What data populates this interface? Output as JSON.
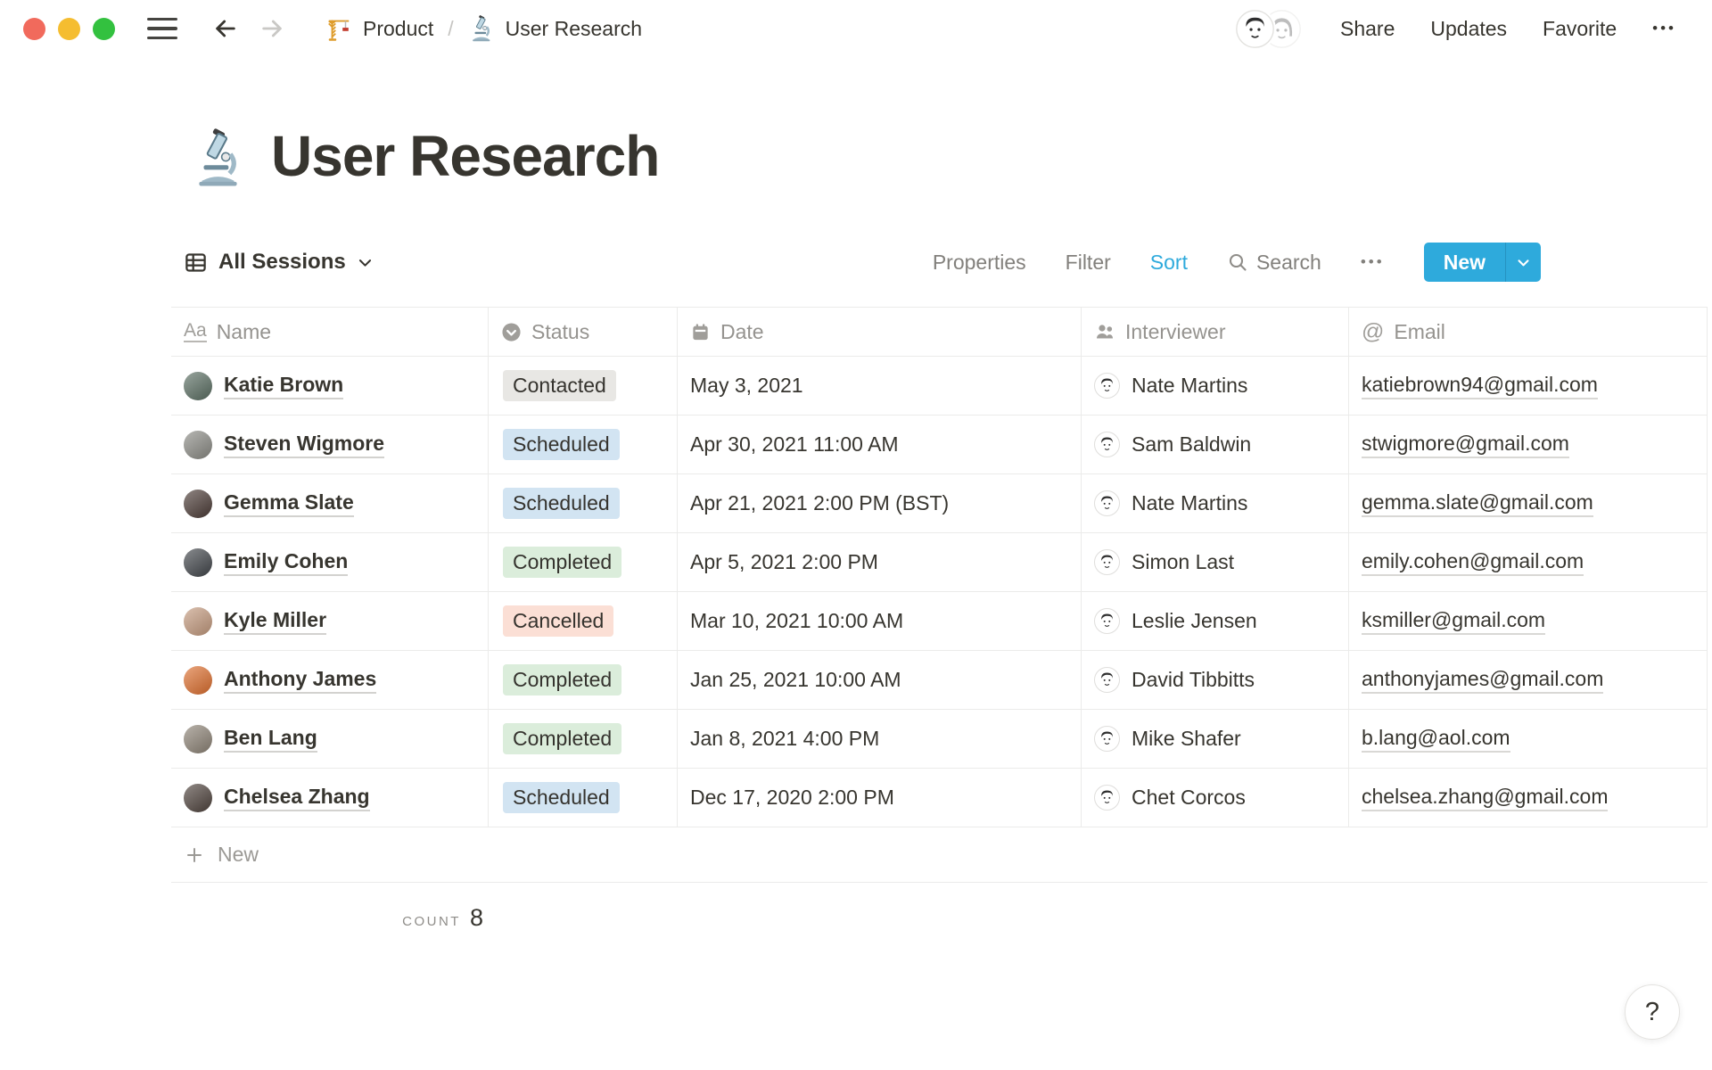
{
  "window": {
    "traffic_lights": [
      "#F16A5C",
      "#F5BD30",
      "#33C13F"
    ]
  },
  "topbar": {
    "breadcrumb": [
      {
        "icon": "crane-icon",
        "label": "Product"
      },
      {
        "icon": "microscope-icon",
        "label": "User Research"
      }
    ],
    "separator": "/",
    "actions": [
      "Share",
      "Updates",
      "Favorite"
    ],
    "more_label": "•••"
  },
  "page": {
    "icon": "microscope-icon",
    "title": "User Research"
  },
  "view_toolbar": {
    "view_name": "All Sessions",
    "menu": [
      {
        "label": "Properties",
        "active": false
      },
      {
        "label": "Filter",
        "active": false
      },
      {
        "label": "Sort",
        "active": true
      }
    ],
    "search_label": "Search",
    "more_label": "•••",
    "accent_color": "#2EAADC",
    "new_button": {
      "label": "New",
      "color": "#2EAADC"
    }
  },
  "table": {
    "columns": [
      {
        "key": "name",
        "label": "Name",
        "icon": "text-icon"
      },
      {
        "key": "status",
        "label": "Status",
        "icon": "select-icon"
      },
      {
        "key": "date",
        "label": "Date",
        "icon": "calendar-icon"
      },
      {
        "key": "interviewer",
        "label": "Interviewer",
        "icon": "person-icon"
      },
      {
        "key": "email",
        "label": "Email",
        "icon": "at-icon"
      }
    ],
    "status_colors": {
      "Contacted": "#E8E7E4",
      "Scheduled": "#D2E4F2",
      "Completed": "#DBEDDB",
      "Cancelled": "#FBDFD5"
    },
    "rows": [
      {
        "name": "Katie Brown",
        "avatar_color": "#5A6E62",
        "status": "Contacted",
        "date": "May 3, 2021",
        "interviewer": "Nate Martins",
        "email": "katiebrown94@gmail.com"
      },
      {
        "name": "Steven Wigmore",
        "avatar_color": "#8B8B85",
        "status": "Scheduled",
        "date": "Apr 30, 2021 11:00 AM",
        "interviewer": "Sam Baldwin",
        "email": "stwigmore@gmail.com"
      },
      {
        "name": "Gemma Slate",
        "avatar_color": "#4B3B36",
        "status": "Scheduled",
        "date": "Apr 21, 2021 2:00 PM (BST)",
        "interviewer": "Nate Martins",
        "email": "gemma.slate@gmail.com"
      },
      {
        "name": "Emily Cohen",
        "avatar_color": "#41454A",
        "status": "Completed",
        "date": "Apr 5, 2021 2:00 PM",
        "interviewer": "Simon Last",
        "email": "emily.cohen@gmail.com"
      },
      {
        "name": "Kyle Miller",
        "avatar_color": "#C49A7E",
        "status": "Cancelled",
        "date": "Mar 10, 2021 10:00 AM",
        "interviewer": "Leslie Jensen",
        "email": "ksmiller@gmail.com"
      },
      {
        "name": "Anthony James",
        "avatar_color": "#DE6F2E",
        "status": "Completed",
        "date": "Jan 25, 2021 10:00 AM",
        "interviewer": "David Tibbitts",
        "email": "anthonyjames@gmail.com"
      },
      {
        "name": "Ben Lang",
        "avatar_color": "#8D8376",
        "status": "Completed",
        "date": "Jan 8, 2021 4:00 PM",
        "interviewer": "Mike Shafer",
        "email": "b.lang@aol.com"
      },
      {
        "name": "Chelsea Zhang",
        "avatar_color": "#4E423C",
        "status": "Scheduled",
        "date": "Dec 17, 2020 2:00 PM",
        "interviewer": "Chet Corcos",
        "email": "chelsea.zhang@gmail.com"
      }
    ],
    "new_row_label": "New",
    "count_label": "COUNT",
    "count_value": "8"
  },
  "help_button": {
    "label": "?"
  }
}
